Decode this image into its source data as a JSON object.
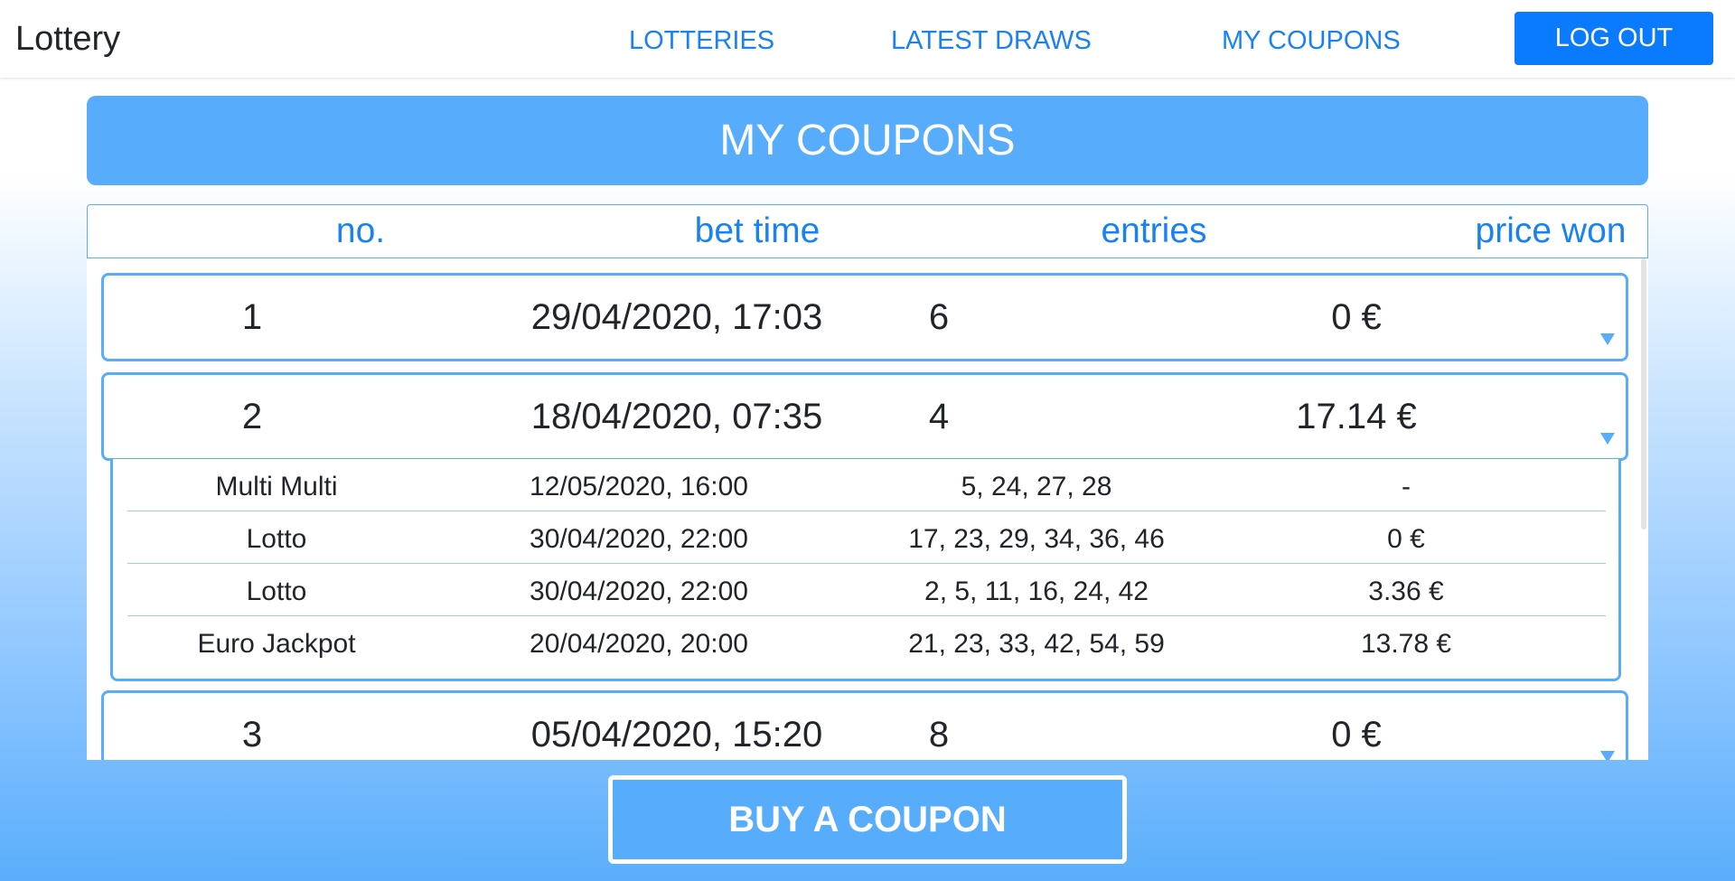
{
  "navbar": {
    "brand": "Lottery",
    "links": [
      "LOTTERIES",
      "LATEST DRAWS",
      "MY COUPONS"
    ],
    "logout_label": "LOG OUT"
  },
  "page": {
    "title": "MY COUPONS",
    "buy_label": "BUY A COUPON"
  },
  "table": {
    "headers": [
      "no.",
      "bet time",
      "entries",
      "price won"
    ],
    "coupons": [
      {
        "no": "1",
        "bet_time": "29/04/2020, 17:03",
        "entries": "6",
        "price_won": "0 €"
      },
      {
        "no": "2",
        "bet_time": "18/04/2020, 07:35",
        "entries": "4",
        "price_won": "17.14 €"
      },
      {
        "no": "3",
        "bet_time": "05/04/2020, 15:20",
        "entries": "8",
        "price_won": "0 €"
      }
    ],
    "expanded_entries": [
      {
        "lottery": "Multi Multi",
        "draw_time": "12/05/2020, 16:00",
        "numbers": "5, 24, 27, 28",
        "won": "-"
      },
      {
        "lottery": "Lotto",
        "draw_time": "30/04/2020, 22:00",
        "numbers": "17, 23, 29, 34, 36, 46",
        "won": "0 €"
      },
      {
        "lottery": "Lotto",
        "draw_time": "30/04/2020, 22:00",
        "numbers": "2, 5, 11, 16, 24, 42",
        "won": "3.36 €"
      },
      {
        "lottery": "Euro Jackpot",
        "draw_time": "20/04/2020, 20:00",
        "numbers": "21, 23, 33, 42, 54, 59",
        "won": "13.78 €"
      }
    ]
  },
  "colors": {
    "accent": "#57acfc",
    "link": "#1a82f0",
    "logout_bg": "#0a7bff"
  },
  "icons": {
    "row_expand": "caret-down-icon"
  }
}
